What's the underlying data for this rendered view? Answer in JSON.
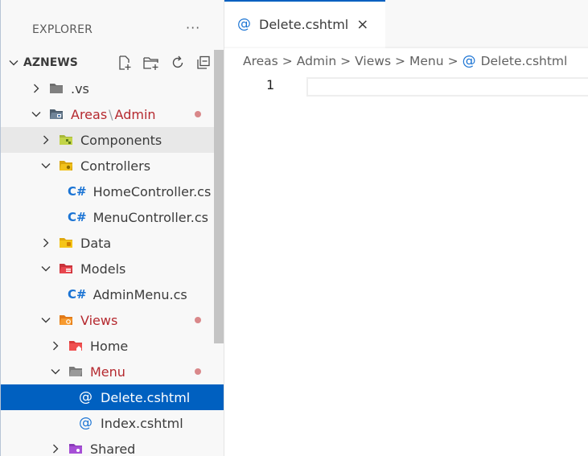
{
  "sidebar": {
    "title": "EXPLORER",
    "more": "···",
    "root": "AZNEWS",
    "tree": [
      {
        "name": "row-vs",
        "indent": 1,
        "chevron": "right",
        "icon": "folder-grey-icon",
        "label": ".vs"
      },
      {
        "name": "row-areas-admin",
        "indent": 1,
        "chevron": "down",
        "icon": "folder-areas-icon",
        "label_a": "Areas",
        "label_sep": "\\",
        "label_b": "Admin",
        "red": true,
        "dot": true
      },
      {
        "name": "row-components",
        "indent": 2,
        "chevron": "right",
        "icon": "folder-components-icon",
        "label": "Components",
        "hover": true
      },
      {
        "name": "row-controllers",
        "indent": 2,
        "chevron": "down",
        "icon": "folder-controllers-icon",
        "label": "Controllers"
      },
      {
        "name": "row-homecontroller",
        "indent": 3,
        "file": "cs",
        "label": "HomeController.cs"
      },
      {
        "name": "row-menucontroller",
        "indent": 3,
        "file": "cs",
        "label": "MenuController.cs"
      },
      {
        "name": "row-data",
        "indent": 2,
        "chevron": "right",
        "icon": "folder-data-icon",
        "label": "Data"
      },
      {
        "name": "row-models",
        "indent": 2,
        "chevron": "down",
        "icon": "folder-models-icon",
        "label": "Models"
      },
      {
        "name": "row-adminmenu",
        "indent": 3,
        "file": "cs",
        "label": "AdminMenu.cs"
      },
      {
        "name": "row-views",
        "indent": 2,
        "chevron": "down",
        "icon": "folder-views-icon",
        "label": "Views",
        "red": true,
        "dot": true
      },
      {
        "name": "row-home",
        "indent": 3,
        "chevron": "right",
        "icon": "folder-home-icon",
        "label": "Home"
      },
      {
        "name": "row-menu",
        "indent": 3,
        "chevron": "down",
        "icon": "folder-menu-icon",
        "label": "Menu",
        "red": true,
        "dot": true
      },
      {
        "name": "row-delete",
        "indent": 4,
        "file": "razor",
        "label": "Delete.cshtml",
        "selected": true
      },
      {
        "name": "row-index",
        "indent": 4,
        "file": "razor",
        "label": "Index.cshtml"
      },
      {
        "name": "row-shared",
        "indent": 3,
        "chevron": "right",
        "icon": "folder-shared-icon",
        "label": "Shared"
      }
    ],
    "icons": {
      "cs": "C#",
      "razor": "@"
    }
  },
  "editor": {
    "tab": {
      "icon": "@",
      "label": "Delete.cshtml",
      "close": "×"
    },
    "breadcrumb": [
      "Areas",
      "Admin",
      "Views",
      "Menu"
    ],
    "breadcrumb_sep": ">",
    "breadcrumb_file_icon": "@",
    "breadcrumb_file": "Delete.cshtml",
    "line_number": "1"
  },
  "colors": {
    "accent": "#0060c0",
    "modified_red": "#b5292f",
    "modified_dot": "#d9888a",
    "file_blue": "#1b74d4"
  }
}
